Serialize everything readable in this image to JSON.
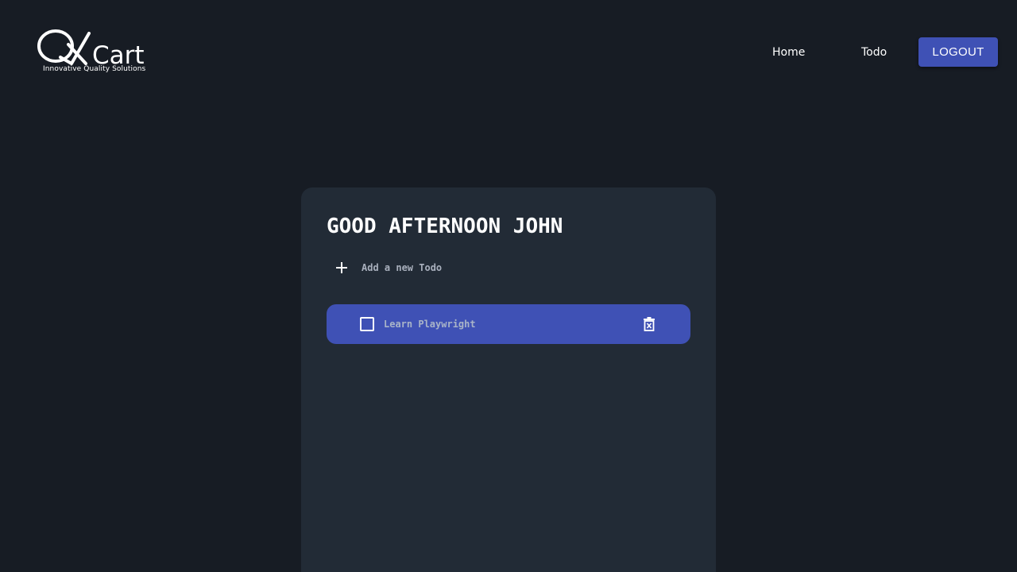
{
  "brand": {
    "logo_text": "QkCart",
    "tagline": "Innovative Quality Solutions"
  },
  "nav": {
    "home_label": "Home",
    "todo_label": "Todo",
    "logout_label": "LOGOUT"
  },
  "main": {
    "greeting": "GOOD AFTERNOON JOHN",
    "add_placeholder": "Add a new Todo",
    "todos": [
      {
        "text": "Learn Playwright",
        "completed": false
      }
    ]
  },
  "colors": {
    "background": "#171c24",
    "card": "#222b36",
    "accent": "#3f51b5"
  }
}
